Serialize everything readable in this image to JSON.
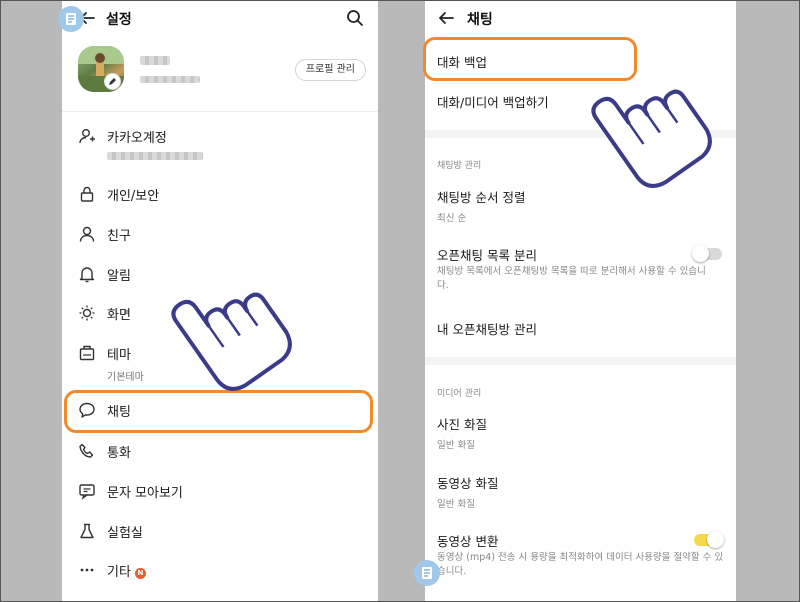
{
  "left": {
    "title": "설정",
    "profile_button": "프로필 관리",
    "items": [
      {
        "label": "카카오계정",
        "icon": "account-icon"
      },
      {
        "label": "개인/보안",
        "icon": "lock-icon"
      },
      {
        "label": "친구",
        "icon": "person-icon"
      },
      {
        "label": "알림",
        "icon": "bell-icon"
      },
      {
        "label": "화면",
        "icon": "brightness-icon"
      },
      {
        "label": "테마",
        "sub": "기본테마",
        "icon": "theme-icon"
      },
      {
        "label": "채팅",
        "icon": "chat-bubble-icon"
      },
      {
        "label": "통화",
        "icon": "phone-icon"
      },
      {
        "label": "문자 모아보기",
        "icon": "message-icon"
      },
      {
        "label": "실험실",
        "icon": "flask-icon"
      },
      {
        "label": "기타",
        "icon": "more-icon",
        "badge": "N"
      }
    ]
  },
  "right": {
    "title": "채팅",
    "backup": {
      "label": "대화 백업"
    },
    "media_backup": {
      "label": "대화/미디어 백업하기"
    },
    "section_chatroom": "채팅방 관리",
    "sort": {
      "label": "채팅방 순서 정렬",
      "sub": "최신 순"
    },
    "open_split": {
      "label": "오픈채팅 목록 분리",
      "sub": "채팅방 목록에서 오픈채팅방 목록을 따로 분리해서 사용할 수 있습니다.",
      "enabled": false
    },
    "my_open": {
      "label": "내 오픈채팅방 관리"
    },
    "section_media": "미디어 관리",
    "photo_quality": {
      "label": "사진 화질",
      "sub": "일반 화질"
    },
    "video_quality": {
      "label": "동영상 화질",
      "sub": "일반 화질"
    },
    "video_convert": {
      "label": "동영상 변환",
      "sub": "동영상 (mp4) 전송 시 용량을 최적화하여 데이터 사용량을 절약할 수 있습니다.",
      "enabled": true
    }
  },
  "colors": {
    "highlight": "#f08a2c",
    "toggle_on": "#f5d94b",
    "badge": "#e85d2c"
  }
}
